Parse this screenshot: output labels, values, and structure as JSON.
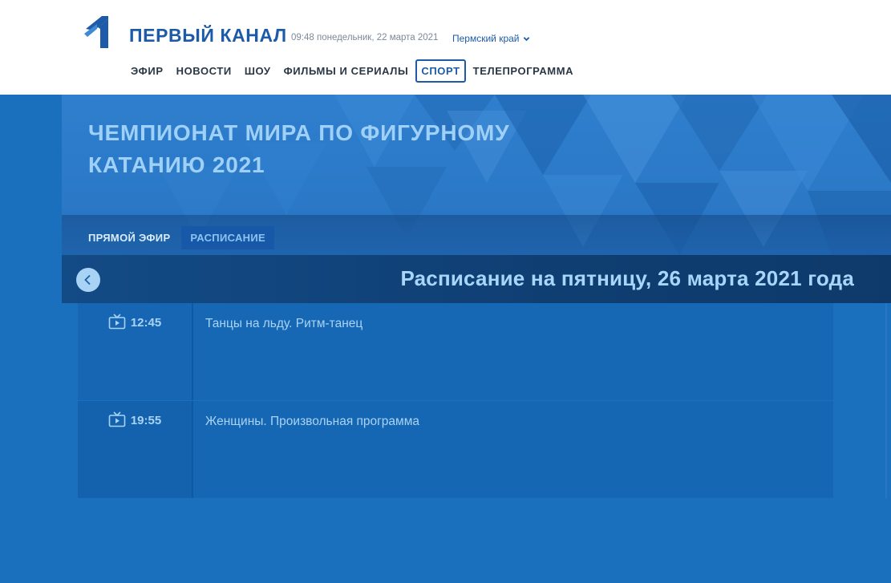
{
  "header": {
    "brand": "ПЕРВЫЙ КАНАЛ",
    "datetime": "09:48 понедельник, 22 марта 2021",
    "region": "Пермский край",
    "nav": [
      {
        "label": "ЭФИР"
      },
      {
        "label": "НОВОСТИ"
      },
      {
        "label": "ШОУ"
      },
      {
        "label": "ФИЛЬМЫ И СЕРИАЛЫ"
      },
      {
        "label": "СПОРТ",
        "active": true
      },
      {
        "label": "ТЕЛЕПРОГРАММА"
      }
    ]
  },
  "hero": {
    "title": "ЧЕМПИОНАТ МИРА ПО ФИГУРНОМУ КАТАНИЮ 2021",
    "tabs": [
      {
        "label": "ПРЯМОЙ ЭФИР"
      },
      {
        "label": "РАСПИСАНИЕ",
        "active": true
      }
    ]
  },
  "schedule": {
    "title": "Расписание на пятницу, 26 марта 2021 года",
    "items": [
      {
        "time": "12:45",
        "program": "Танцы на льду. Ритм-танец",
        "icon": "tv-play-icon"
      },
      {
        "time": "19:55",
        "program": "Женщины. Произвольная программа",
        "icon": "tv-play-icon"
      }
    ]
  },
  "colors": {
    "brand": "#1d5ba8",
    "background": "#1b70be",
    "accent_text": "#a9d3f5",
    "schedule_header": "#0f3e72"
  }
}
